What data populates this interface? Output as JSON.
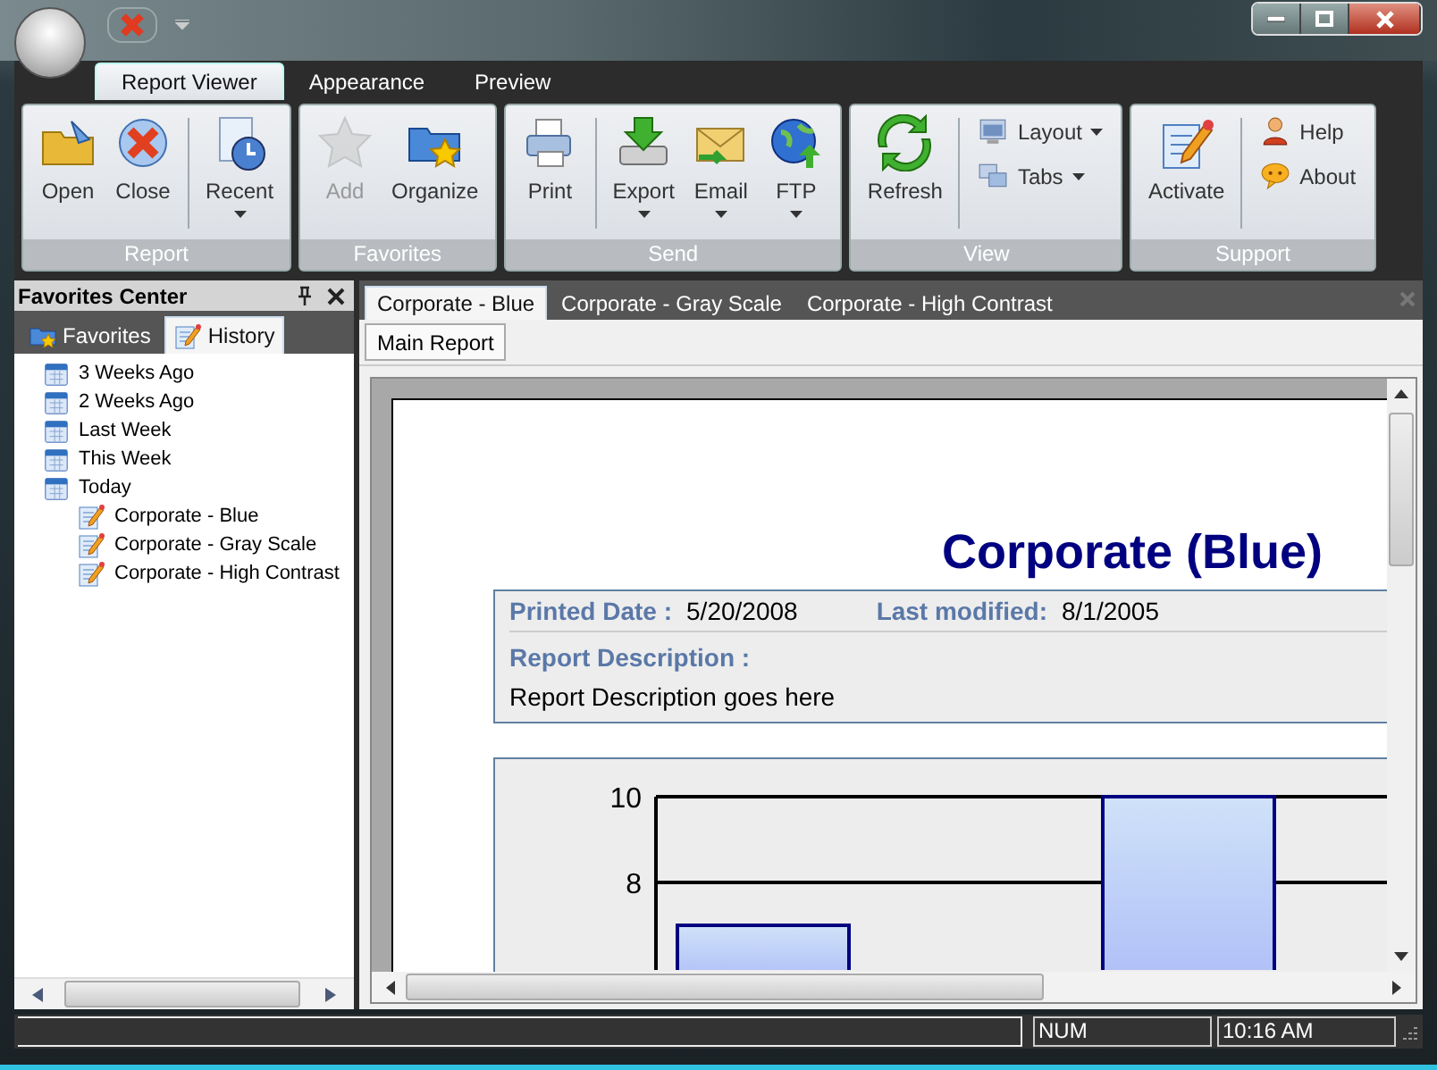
{
  "ribbon": {
    "tabs": [
      {
        "label": "Report Viewer",
        "selected": true
      },
      {
        "label": "Appearance",
        "selected": false
      },
      {
        "label": "Preview",
        "selected": false
      }
    ],
    "groups": [
      {
        "label": "Report",
        "items": [
          {
            "kind": "large",
            "label": "Open",
            "disabled": false,
            "dropdown": false
          },
          {
            "kind": "large",
            "label": "Close",
            "disabled": false,
            "dropdown": false
          },
          {
            "kind": "separator"
          },
          {
            "kind": "large",
            "label": "Recent",
            "disabled": false,
            "dropdown": true
          }
        ]
      },
      {
        "label": "Favorites",
        "items": [
          {
            "kind": "large",
            "label": "Add",
            "disabled": true,
            "dropdown": false
          },
          {
            "kind": "large",
            "label": "Organize",
            "disabled": false,
            "dropdown": false
          }
        ]
      },
      {
        "label": "Send",
        "items": [
          {
            "kind": "large",
            "label": "Print",
            "disabled": false,
            "dropdown": false
          },
          {
            "kind": "separator"
          },
          {
            "kind": "large",
            "label": "Export",
            "disabled": false,
            "dropdown": true
          },
          {
            "kind": "large",
            "label": "Email",
            "disabled": false,
            "dropdown": true
          },
          {
            "kind": "large",
            "label": "FTP",
            "disabled": false,
            "dropdown": true
          }
        ]
      },
      {
        "label": "View",
        "items": [
          {
            "kind": "large",
            "label": "Refresh",
            "disabled": false,
            "dropdown": false
          },
          {
            "kind": "separator"
          },
          {
            "kind": "small",
            "label": "Layout",
            "disabled": false,
            "dropdown": true
          },
          {
            "kind": "small",
            "label": "Tabs",
            "disabled": false,
            "dropdown": true
          }
        ]
      },
      {
        "label": "Support",
        "items": [
          {
            "kind": "large",
            "label": "Activate",
            "disabled": false,
            "dropdown": false
          },
          {
            "kind": "separator"
          },
          {
            "kind": "small",
            "label": "Help",
            "disabled": false,
            "dropdown": false
          },
          {
            "kind": "small",
            "label": "About",
            "disabled": false,
            "dropdown": false
          }
        ]
      }
    ]
  },
  "favorites_center": {
    "title": "Favorites Center",
    "tabs": [
      {
        "label": "Favorites",
        "selected": false
      },
      {
        "label": "History",
        "selected": true
      }
    ],
    "tree": [
      {
        "label": "3 Weeks Ago"
      },
      {
        "label": "2 Weeks Ago"
      },
      {
        "label": "Last Week"
      },
      {
        "label": "This Week"
      },
      {
        "label": "Today",
        "expanded": true,
        "children": [
          {
            "label": "Corporate - Blue"
          },
          {
            "label": "Corporate - Gray Scale"
          },
          {
            "label": "Corporate - High Contrast"
          }
        ]
      }
    ]
  },
  "document_tabs": [
    {
      "label": "Corporate - Blue",
      "selected": true
    },
    {
      "label": "Corporate - Gray Scale",
      "selected": false
    },
    {
      "label": "Corporate - High Contrast",
      "selected": false
    }
  ],
  "report_tabs": [
    {
      "label": "Main Report",
      "selected": true
    }
  ],
  "report": {
    "title": "Corporate (Blue)",
    "printed_date_label": "Printed Date :",
    "printed_date": "5/20/2008",
    "last_modified_label": "Last modified:",
    "last_modified": "8/1/2005",
    "description_label": "Report Description :",
    "description": "Report Description goes here",
    "chart_data": {
      "type": "bar",
      "values": [
        7,
        10
      ],
      "ylim": [
        6,
        10
      ],
      "yticks": [
        8,
        10
      ]
    }
  },
  "status_bar": {
    "num": "NUM",
    "time": "10:16 AM"
  }
}
